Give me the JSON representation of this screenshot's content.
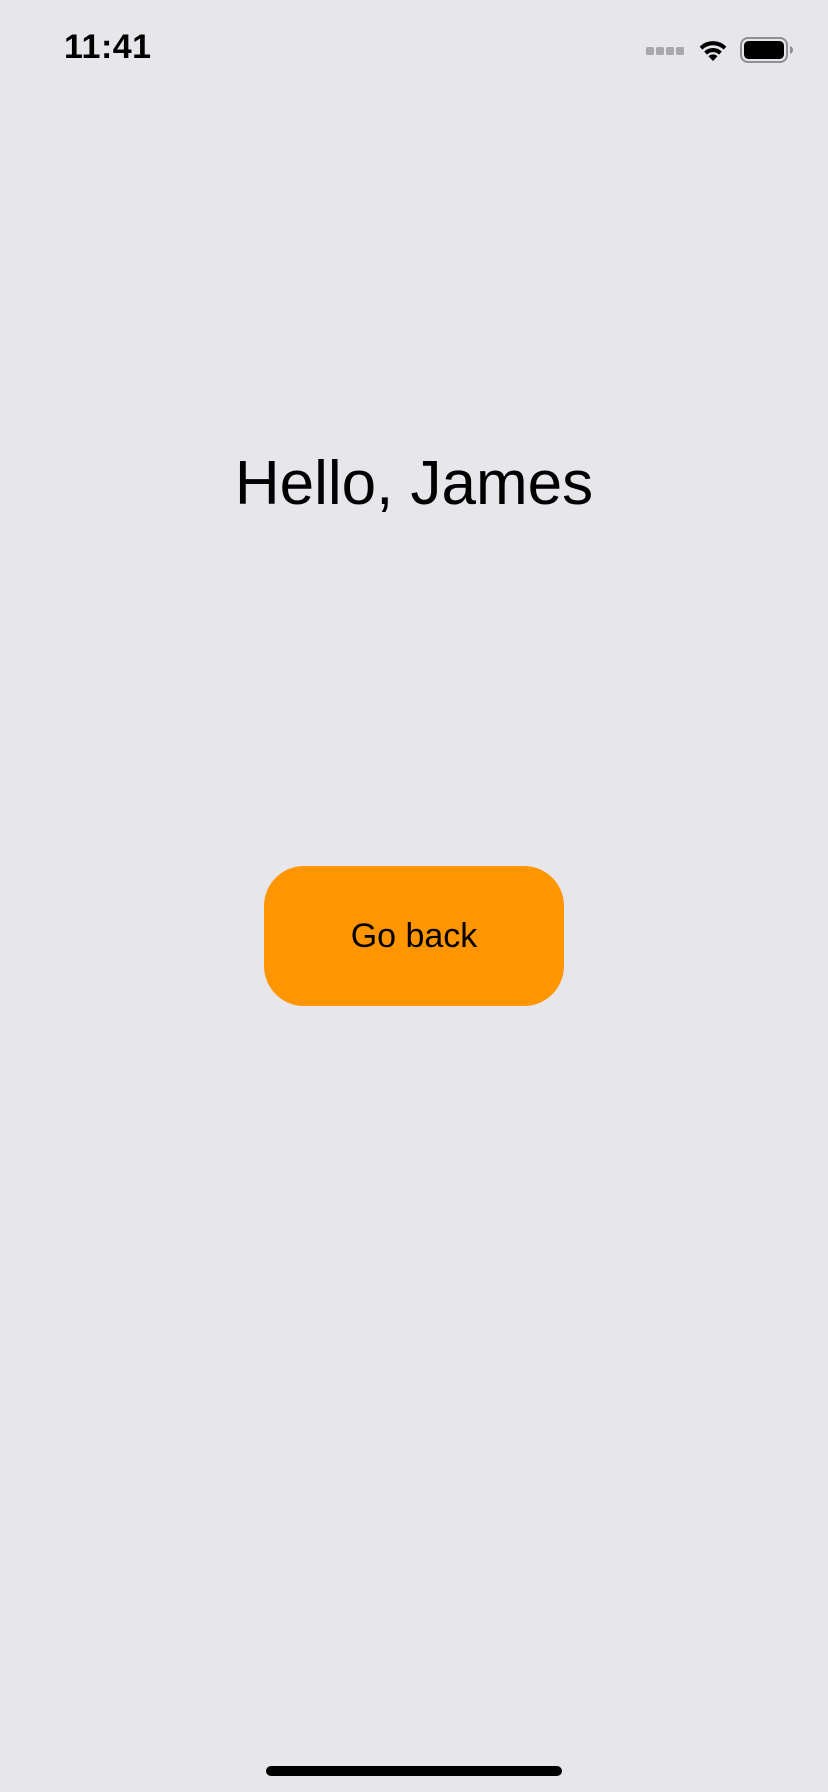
{
  "status_bar": {
    "time": "11:41",
    "signal_icon": "cellular-signal-icon",
    "wifi_icon": "wifi-icon",
    "battery_icon": "battery-icon"
  },
  "main": {
    "greeting": "Hello, James",
    "go_back_label": "Go back"
  },
  "colors": {
    "background": "#e6e6eb",
    "button": "#ff9500",
    "text": "#000000"
  }
}
